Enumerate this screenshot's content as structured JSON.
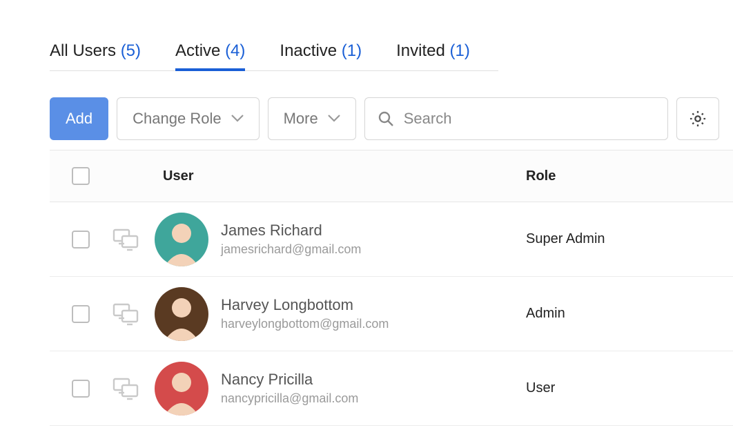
{
  "tabs": [
    {
      "label": "All Users",
      "count": "(5)",
      "active": false
    },
    {
      "label": "Active",
      "count": "(4)",
      "active": true
    },
    {
      "label": "Inactive",
      "count": "(1)",
      "active": false
    },
    {
      "label": "Invited",
      "count": "(1)",
      "active": false
    }
  ],
  "toolbar": {
    "add_label": "Add",
    "change_role_label": "Change Role",
    "more_label": "More",
    "search_placeholder": "Search"
  },
  "columns": {
    "user": "User",
    "role": "Role"
  },
  "users": [
    {
      "name": "James Richard",
      "email": "jamesrichard@gmail.com",
      "role": "Super Admin",
      "avatar_bg": "#3fa69b"
    },
    {
      "name": "Harvey Longbottom",
      "email": "harveylongbottom@gmail.com",
      "role": "Admin",
      "avatar_bg": "#5a3a22"
    },
    {
      "name": "Nancy Pricilla",
      "email": "nancypricilla@gmail.com",
      "role": "User",
      "avatar_bg": "#d44b4b"
    }
  ]
}
